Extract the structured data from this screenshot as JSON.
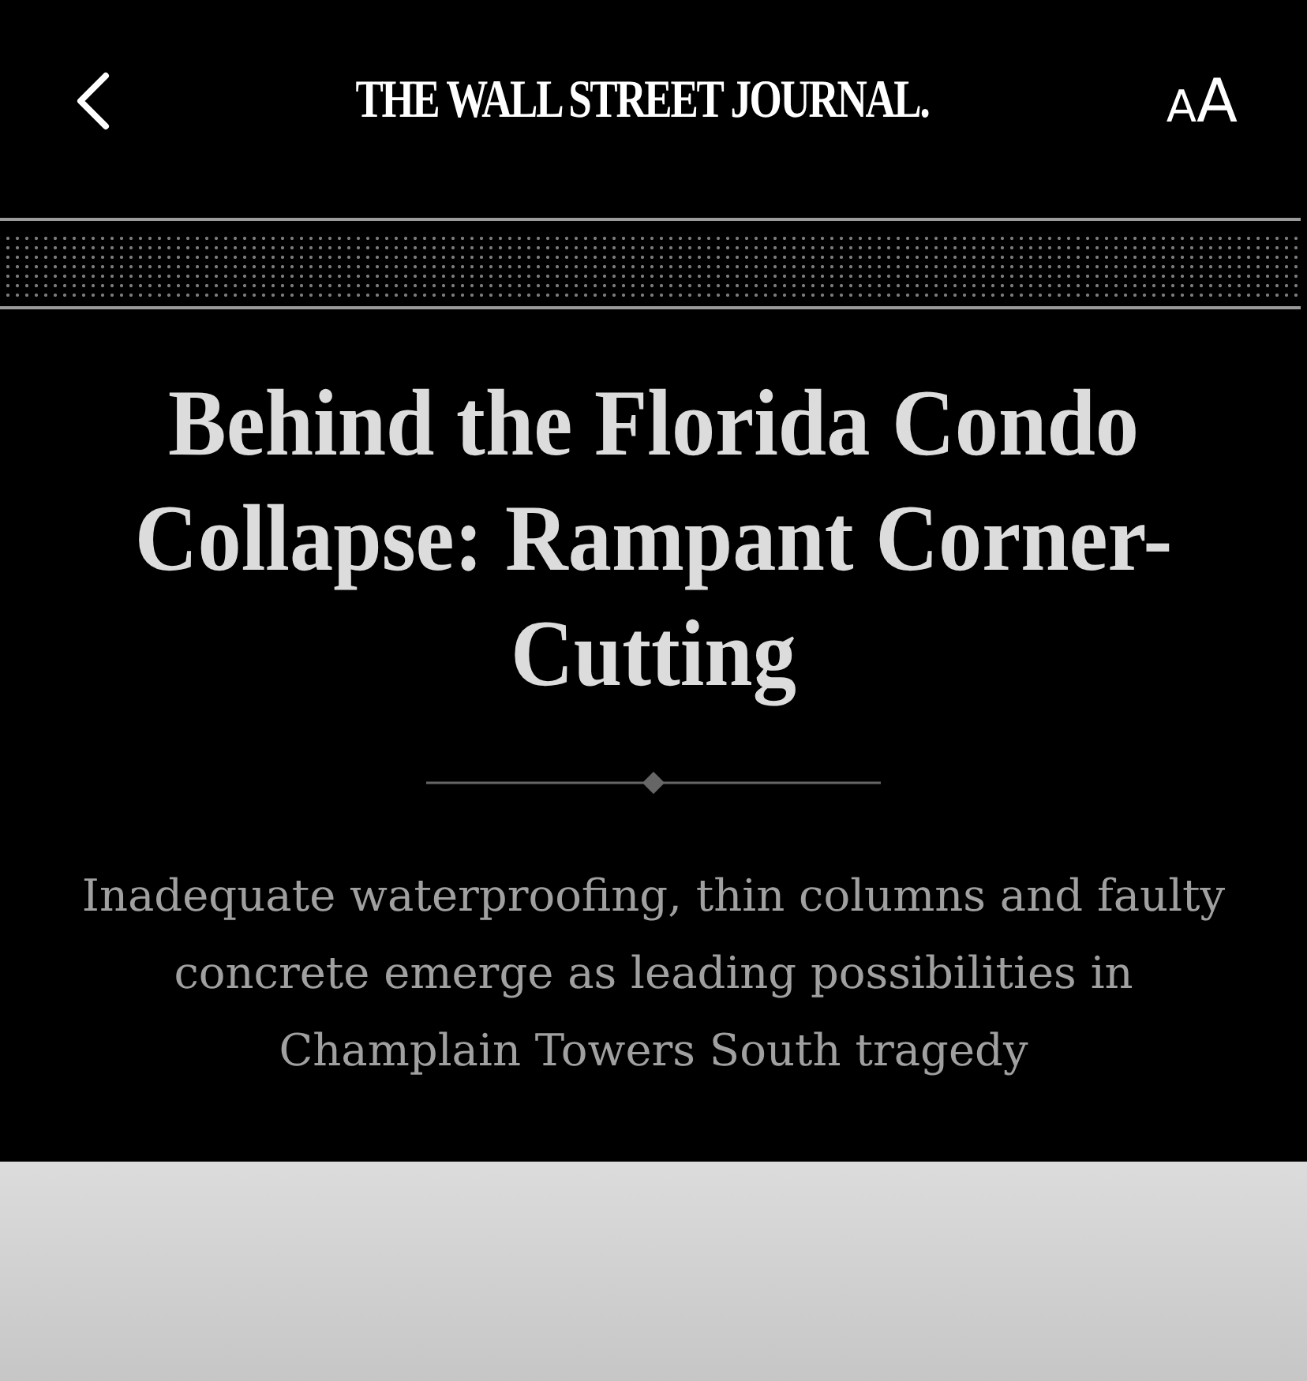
{
  "header": {
    "masthead": "THE WALL STREET JOURNAL.",
    "text_size_button": {
      "small": "A",
      "large": "A"
    }
  },
  "article": {
    "headline": "Behind the Florida Condo Collapse: Rampant Corner-Cutting",
    "dek": "Inadequate waterproofing, thin columns and faulty concrete emerge as leading possibilities in Champlain Towers South tragedy"
  }
}
